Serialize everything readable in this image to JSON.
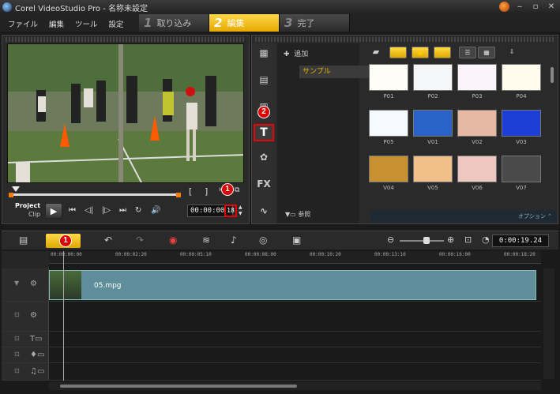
{
  "window": {
    "title": "Corel VideoStudio Pro - 名称未設定",
    "min": "‒",
    "max": "▫",
    "close": "✕"
  },
  "menu": [
    "ファイル",
    "編集",
    "ツール",
    "設定"
  ],
  "steps": [
    {
      "num": "1",
      "label": "取り込み",
      "active": false
    },
    {
      "num": "2",
      "label": "編集",
      "active": true
    },
    {
      "num": "3",
      "label": "完了",
      "active": false
    }
  ],
  "player": {
    "mode_project": "Project",
    "mode_clip": "Clip",
    "timecode": "00:00:00",
    "frame": "18",
    "trim_in": "[",
    "trim_out": "]"
  },
  "badges": {
    "one": "1",
    "two": "2"
  },
  "library": {
    "add_label": "追加",
    "folder": "サンプル",
    "browse_label": "参照",
    "options_label": "オプション",
    "side_icons": [
      "media-icon",
      "instant-project-icon",
      "transition-icon",
      "title-icon",
      "graphic-icon",
      "filter-icon",
      "path-icon"
    ],
    "side_text": {
      "title": "T",
      "fx": "FX"
    },
    "thumbnails": [
      {
        "caption": "P01",
        "color": "#fdfdf6"
      },
      {
        "caption": "P02",
        "color": "#f4f6f8"
      },
      {
        "caption": "P03",
        "color": "#fbf4fb"
      },
      {
        "caption": "P04",
        "color": "#fffcee"
      },
      {
        "caption": "P05",
        "color": "#f6fafe"
      },
      {
        "caption": "V01",
        "color": "#2a63c7"
      },
      {
        "caption": "V02",
        "color": "#e7b8a4"
      },
      {
        "caption": "V03",
        "color": "#1c3fd8"
      },
      {
        "caption": "V04",
        "color": "#c79030"
      },
      {
        "caption": "V05",
        "color": "#f1c08a"
      },
      {
        "caption": "V06",
        "color": "#efc7c1"
      },
      {
        "caption": "V07",
        "color": "#4a4a4a"
      }
    ]
  },
  "timeline": {
    "time": "0:00:19.24",
    "ruler": [
      "00:00:00:00",
      "00:00:02:20",
      "00:00:05:10",
      "00:00:08:00",
      "00:00:10:20",
      "00:00:13:10",
      "00:00:16:00",
      "00:00:18:20"
    ],
    "clip_name": "05.mpg"
  }
}
